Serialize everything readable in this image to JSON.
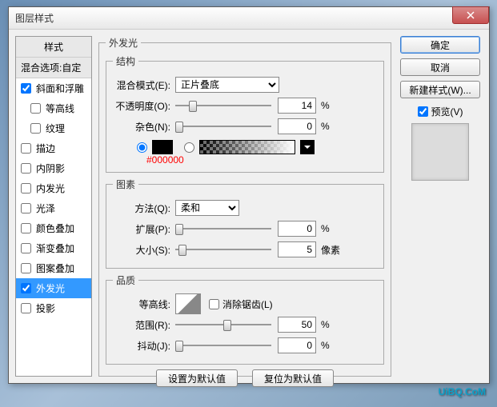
{
  "title": "图层样式",
  "sidebar": {
    "header": "样式",
    "sub": "混合选项:自定",
    "items": [
      {
        "label": "斜面和浮雕",
        "checked": true,
        "selected": false
      },
      {
        "label": "等高线",
        "checked": false,
        "selected": false,
        "indent": true
      },
      {
        "label": "纹理",
        "checked": false,
        "selected": false,
        "indent": true
      },
      {
        "label": "描边",
        "checked": false,
        "selected": false
      },
      {
        "label": "内阴影",
        "checked": false,
        "selected": false
      },
      {
        "label": "内发光",
        "checked": false,
        "selected": false
      },
      {
        "label": "光泽",
        "checked": false,
        "selected": false
      },
      {
        "label": "颜色叠加",
        "checked": false,
        "selected": false
      },
      {
        "label": "渐变叠加",
        "checked": false,
        "selected": false
      },
      {
        "label": "图案叠加",
        "checked": false,
        "selected": false
      },
      {
        "label": "外发光",
        "checked": true,
        "selected": true
      },
      {
        "label": "投影",
        "checked": false,
        "selected": false
      }
    ]
  },
  "panel": {
    "title": "外发光",
    "structure": {
      "legend": "结构",
      "blendMode": {
        "label": "混合模式(E):",
        "value": "正片叠底"
      },
      "opacity": {
        "label": "不透明度(O):",
        "value": "14",
        "unit": "%",
        "pos": 14
      },
      "noise": {
        "label": "杂色(N):",
        "value": "0",
        "unit": "%",
        "pos": 0
      },
      "hex": "#000000"
    },
    "elements": {
      "legend": "图素",
      "technique": {
        "label": "方法(Q):",
        "value": "柔和"
      },
      "spread": {
        "label": "扩展(P):",
        "value": "0",
        "unit": "%",
        "pos": 0
      },
      "size": {
        "label": "大小(S):",
        "value": "5",
        "unit": "像素",
        "pos": 3
      }
    },
    "quality": {
      "legend": "品质",
      "contour": {
        "label": "等高线:"
      },
      "antialias": {
        "label": "消除锯齿(L)",
        "checked": false
      },
      "range": {
        "label": "范围(R):",
        "value": "50",
        "unit": "%",
        "pos": 50
      },
      "jitter": {
        "label": "抖动(J):",
        "value": "0",
        "unit": "%",
        "pos": 0
      }
    },
    "defaultBtn": "设置为默认值",
    "resetBtn": "复位为默认值"
  },
  "buttons": {
    "ok": "确定",
    "cancel": "取消",
    "newStyle": "新建样式(W)...",
    "preview": "预览(V)"
  },
  "watermark": "UiBQ.CoM"
}
